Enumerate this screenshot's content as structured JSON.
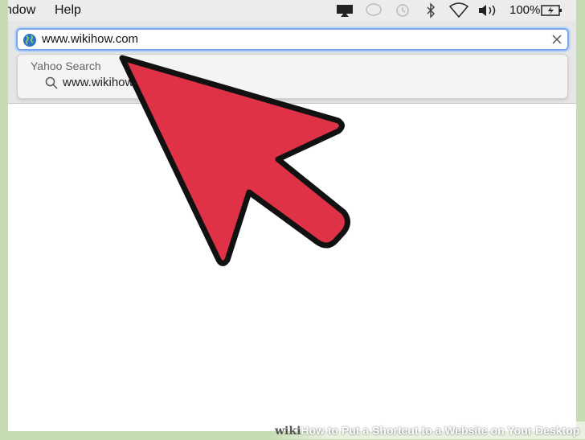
{
  "menubar": {
    "items": [
      "ndow",
      "Help"
    ],
    "battery_label": "100%"
  },
  "address_bar": {
    "url": "www.wikihow.com"
  },
  "suggestions": {
    "heading": "Yahoo Search",
    "item": "www.wikihow"
  },
  "footer": {
    "wiki": "wiki",
    "how": "How",
    "caption": " to Put a Shortcut to a Website on Your Desktop"
  },
  "colors": {
    "frame": "#c5dbb2",
    "cursor_fill": "#e03247",
    "focus_ring": "#7aaaf0"
  }
}
